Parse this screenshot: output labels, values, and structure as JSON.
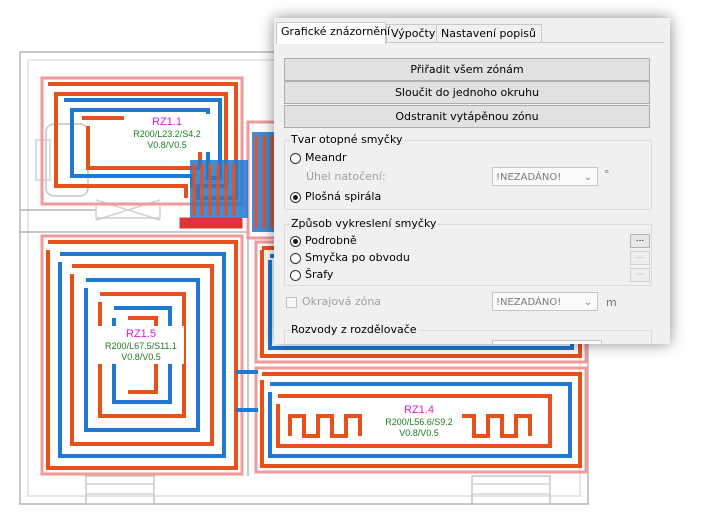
{
  "colors": {
    "supply_pipe": "#e8501a",
    "return_pipe": "#1f78d1",
    "zone_outline": "#f29a9a",
    "wall": "#b5b5b5",
    "zone_name": "#d61ad6",
    "zone_params": "#1f7a1f"
  },
  "zones": [
    {
      "name": "RZ1.1",
      "params": "R200/L23.2/S4.2",
      "valves": "V0.8/V0.5"
    },
    {
      "name": "RZ1.5",
      "params": "R200/L67.5/S11.1",
      "valves": "V0.8/V0.5"
    },
    {
      "name": "RZ1.4",
      "params": "R200/L56.6/S9.2",
      "valves": "V0.8/V0.5"
    }
  ],
  "panel": {
    "tabs": [
      {
        "label": "Grafické znázornění",
        "active": true
      },
      {
        "label": "Výpočty",
        "active": false
      },
      {
        "label": "Nastavení popisů",
        "active": false
      }
    ],
    "buttons": {
      "assign_all": "Přiřadit všem zónám",
      "merge": "Sloučit do jednoho okruhu",
      "remove": "Odstranit vytápěnou zónu"
    },
    "loop_shape": {
      "title": "Tvar otopné smyčky",
      "meander": "Meandr",
      "rotation_label": "Úhel natočení:",
      "rotation_value": "!NEZADÁNO!",
      "rotation_unit": "°",
      "spiral": "Plošná spirála",
      "selected": "spiral"
    },
    "drawing_mode": {
      "title": "Způsob vykreslení smyčky",
      "detailed": "Podrobně",
      "perimeter": "Smyčka po obvodu",
      "hatch": "Šrafy",
      "selected": "detailed",
      "ellipsis": "..."
    },
    "edge_zone": {
      "label": "Okrajová zóna",
      "value": "!NEZADÁNO!",
      "unit": "m"
    },
    "distribution": {
      "title": "Rozvody z rozdělovače"
    }
  }
}
